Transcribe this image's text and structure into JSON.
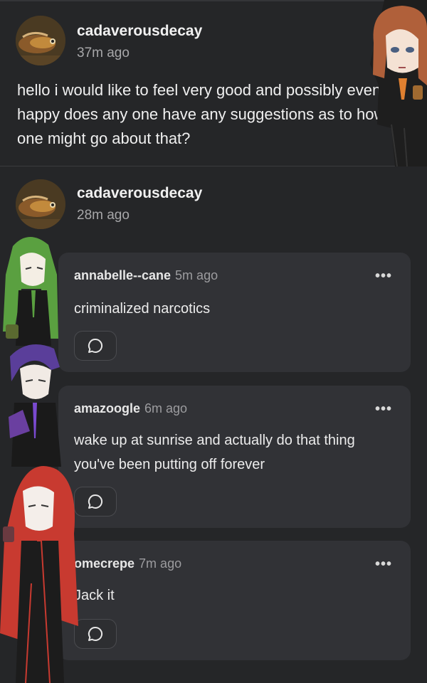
{
  "post1": {
    "username": "cadaverousdecay",
    "time": "37m ago",
    "body": "hello i would like to feel very good and possibly even happy does any one have any suggestions as to how one might go about that?"
  },
  "post2": {
    "username": "cadaverousdecay",
    "time": "28m ago"
  },
  "replies": [
    {
      "username": "annabelle--cane",
      "time": "5m ago",
      "text": "criminalized narcotics"
    },
    {
      "username": "amazoogle",
      "time": "6m ago",
      "text": "wake up at sunrise and actually do that thing you've been putting off forever"
    },
    {
      "username": "omecrepe",
      "time": "7m ago",
      "text": "Jack it"
    }
  ],
  "icons": {
    "more": "more-dots-icon",
    "comment": "comment-bubble-icon"
  },
  "colors": {
    "background": "#252628",
    "card": "#313236",
    "muted": "#a7a7a9"
  }
}
